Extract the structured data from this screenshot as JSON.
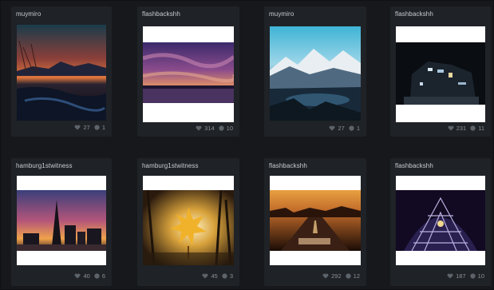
{
  "posts": [
    {
      "username": "muymiro",
      "likes": "27",
      "comments": "1",
      "image": "sunset-lake-mountains"
    },
    {
      "username": "flashbackshh",
      "likes": "314",
      "comments": "10",
      "image": "purple-clouds-river"
    },
    {
      "username": "muymiro",
      "likes": "27",
      "comments": "1",
      "image": "snowy-mountain-lake"
    },
    {
      "username": "flashbackshh",
      "likes": "231",
      "comments": "11",
      "image": "night-building"
    },
    {
      "username": "hamburg1stwitness",
      "likes": "40",
      "comments": "6",
      "image": "city-skyline-dusk"
    },
    {
      "username": "hamburg1stwitness",
      "likes": "45",
      "comments": "3",
      "image": "autumn-leaf-park"
    },
    {
      "username": "flashbackshh",
      "likes": "292",
      "comments": "12",
      "image": "road-sunset"
    },
    {
      "username": "flashbackshh",
      "likes": "187",
      "comments": "10",
      "image": "glass-dome-night"
    }
  ],
  "icons": {
    "likes": "heart-icon",
    "comments": "comment-icon"
  }
}
